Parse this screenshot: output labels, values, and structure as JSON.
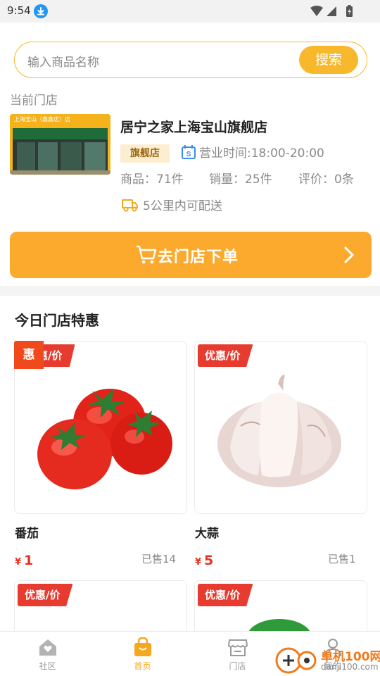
{
  "status_bar": {
    "time": "9:54"
  },
  "search": {
    "placeholder": "输入商品名称",
    "button": "搜索"
  },
  "current_store_label": "当前门店",
  "store": {
    "name": "居宁之家上海宝山旗舰店",
    "badge": "旗舰店",
    "hours": "营业时间:18:00-20:00",
    "products": "商品：71件",
    "sales": "销量：25件",
    "reviews": "评价：0条",
    "delivery": "5公里内可配送",
    "sign_text": "上海宝山（鑫鑫店）店"
  },
  "order_button": "去门店下单",
  "section_title": "今日门店特惠",
  "hui_badge": "惠",
  "products": [
    {
      "tag": "惠/价",
      "name": "番茄",
      "currency": "¥",
      "price": "1",
      "sold": "已售14"
    },
    {
      "tag": "优惠/价",
      "name": "大蒜",
      "currency": "¥",
      "price": "5",
      "sold": "已售1"
    },
    {
      "tag": "优惠/价"
    },
    {
      "tag": "优惠/价"
    }
  ],
  "nav": [
    {
      "label": "社区"
    },
    {
      "label": "首页"
    },
    {
      "label": "门店"
    },
    {
      "label": "我的"
    }
  ],
  "watermark": {
    "brand": "单机100网",
    "url": "danji100.com"
  },
  "colors": {
    "accent": "#fcaa2e",
    "price": "#e8321f",
    "tag": "#e63b2e"
  }
}
